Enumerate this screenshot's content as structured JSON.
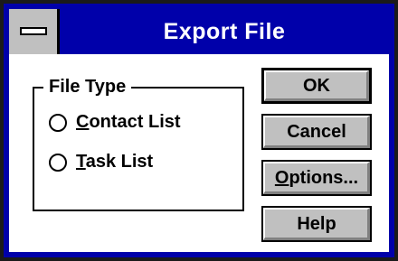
{
  "window": {
    "title": "Export File"
  },
  "group": {
    "title": "File Type",
    "options": [
      {
        "label_prefix": "",
        "label_underlined": "C",
        "label_rest": "ontact List"
      },
      {
        "label_prefix": "",
        "label_underlined": "T",
        "label_rest": "ask List"
      }
    ]
  },
  "buttons": {
    "ok": "OK",
    "cancel": "Cancel",
    "options_underlined": "O",
    "options_rest": "ptions...",
    "help": "Help"
  }
}
